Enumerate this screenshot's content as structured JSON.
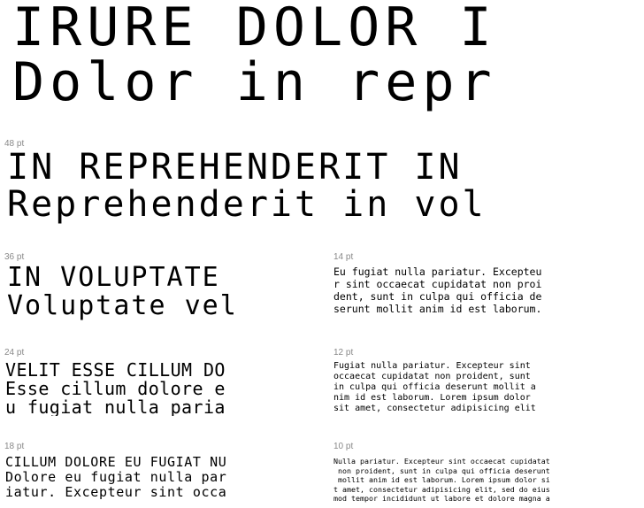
{
  "specimens": {
    "pt72": {
      "line1": "IRURE DOLOR I",
      "line2": "Dolor in repr"
    },
    "pt48": {
      "size_label": "48 pt",
      "line1": "IN REPREHENDERIT IN",
      "line2": "Reprehenderit in vol"
    },
    "pt36": {
      "size_label": "36 pt",
      "line1": "IN VOLUPTATE",
      "line2": "Voluptate vel"
    },
    "pt24": {
      "size_label": "24 pt",
      "line1": "VELIT ESSE CILLUM DO",
      "line2": "Esse cillum dolore e",
      "line3": "u fugiat nulla paria"
    },
    "pt18": {
      "size_label": "18 pt",
      "line1": "CILLUM DOLORE EU FUGIAT NU",
      "line2": "Dolore eu fugiat nulla par",
      "line3": "iatur. Excepteur sint occa"
    },
    "pt14": {
      "size_label": "14 pt",
      "line1": "Eu fugiat nulla pariatur. Excepteu",
      "line2": "r sint occaecat cupidatat non proi",
      "line3": "dent, sunt in culpa qui officia de",
      "line4": "serunt mollit anim id est laborum."
    },
    "pt12": {
      "size_label": "12 pt",
      "line1": "Fugiat nulla pariatur. Excepteur sint",
      "line2": "occaecat cupidatat non proident, sunt",
      "line3": "in culpa qui officia deserunt mollit a",
      "line4": "nim id est laborum. Lorem ipsum dolor",
      "line5": "sit amet, consectetur adipisicing elit"
    },
    "pt10": {
      "size_label": "10 pt",
      "line1": "Nulla pariatur. Excepteur sint occaecat cupidatat",
      "line2": " non proident, sunt in culpa qui officia deserunt",
      "line3": " mollit anim id est laborum. Lorem ipsum dolor si",
      "line4": "t amet, consectetur adipisicing elit, sed do eius",
      "line5": "mod tempor incididunt ut labore et dolore magna a"
    }
  }
}
